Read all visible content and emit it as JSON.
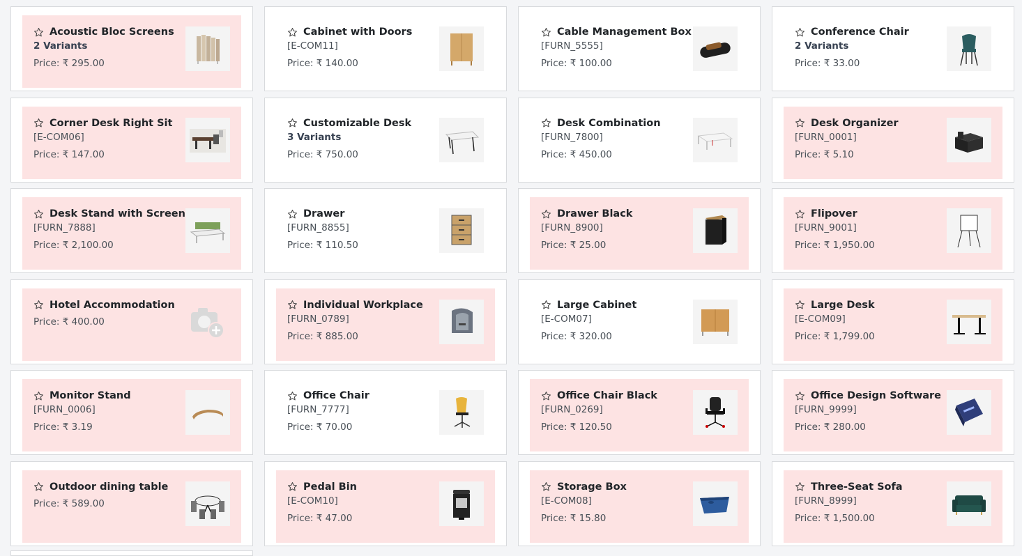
{
  "currency": "₹",
  "price_label": "Price:",
  "colors": {
    "highlight": "#fde3e3",
    "card": "#ffffff",
    "border": "#d8dadd"
  },
  "products": [
    {
      "name": "Acoustic Bloc Screens",
      "sub": "2 Variants",
      "sub_type": "variants",
      "price": "295.00",
      "highlight": true,
      "icon": "acoustic-screens"
    },
    {
      "name": "Cabinet with Doors",
      "sub": "[E-COM11]",
      "sub_type": "code",
      "price": "140.00",
      "highlight": false,
      "icon": "cabinet-doors"
    },
    {
      "name": "Cable Management Box",
      "sub": "[FURN_5555]",
      "sub_type": "code",
      "price": "100.00",
      "highlight": false,
      "icon": "cable-box"
    },
    {
      "name": "Conference Chair",
      "sub": "2 Variants",
      "sub_type": "variants",
      "price": "33.00",
      "highlight": false,
      "icon": "chair-teal"
    },
    {
      "name": "Corner Desk Right Sit",
      "sub": "[E-COM06]",
      "sub_type": "code",
      "price": "147.00",
      "highlight": true,
      "icon": "corner-desk"
    },
    {
      "name": "Customizable Desk",
      "sub": "3 Variants",
      "sub_type": "variants",
      "price": "750.00",
      "highlight": false,
      "icon": "desk-white"
    },
    {
      "name": "Desk Combination",
      "sub": "[FURN_7800]",
      "sub_type": "code",
      "price": "450.00",
      "highlight": false,
      "icon": "desk-combo"
    },
    {
      "name": "Desk Organizer",
      "sub": "[FURN_0001]",
      "sub_type": "code",
      "price": "5.10",
      "highlight": true,
      "icon": "organizer"
    },
    {
      "name": "Desk Stand with Screen",
      "sub": "[FURN_7888]",
      "sub_type": "code",
      "price": "2,100.00",
      "highlight": true,
      "icon": "desk-stand-screen"
    },
    {
      "name": "Drawer",
      "sub": "[FURN_8855]",
      "sub_type": "code",
      "price": "110.50",
      "highlight": false,
      "icon": "drawer-wood"
    },
    {
      "name": "Drawer Black",
      "sub": "[FURN_8900]",
      "sub_type": "code",
      "price": "25.00",
      "highlight": true,
      "icon": "drawer-black"
    },
    {
      "name": "Flipover",
      "sub": "[FURN_9001]",
      "sub_type": "code",
      "price": "1,950.00",
      "highlight": true,
      "icon": "flipover"
    },
    {
      "name": "Hotel Accommodation",
      "sub": "",
      "sub_type": "none",
      "price": "400.00",
      "highlight": true,
      "icon": "camera-placeholder"
    },
    {
      "name": "Individual Workplace",
      "sub": "[FURN_0789]",
      "sub_type": "code",
      "price": "885.00",
      "highlight": true,
      "icon": "workplace-pod"
    },
    {
      "name": "Large Cabinet",
      "sub": "[E-COM07]",
      "sub_type": "code",
      "price": "320.00",
      "highlight": false,
      "icon": "large-cabinet"
    },
    {
      "name": "Large Desk",
      "sub": "[E-COM09]",
      "sub_type": "code",
      "price": "1,799.00",
      "highlight": true,
      "icon": "large-desk"
    },
    {
      "name": "Monitor Stand",
      "sub": "[FURN_0006]",
      "sub_type": "code",
      "price": "3.19",
      "highlight": true,
      "icon": "monitor-stand"
    },
    {
      "name": "Office Chair",
      "sub": "[FURN_7777]",
      "sub_type": "code",
      "price": "70.00",
      "highlight": false,
      "icon": "office-chair-yellow"
    },
    {
      "name": "Office Chair Black",
      "sub": "[FURN_0269]",
      "sub_type": "code",
      "price": "120.50",
      "highlight": true,
      "icon": "office-chair-black"
    },
    {
      "name": "Office Design Software",
      "sub": "[FURN_9999]",
      "sub_type": "code",
      "price": "280.00",
      "highlight": true,
      "icon": "software-box"
    },
    {
      "name": "Outdoor dining table",
      "sub": "",
      "sub_type": "none",
      "price": "589.00",
      "highlight": true,
      "icon": "dining-table"
    },
    {
      "name": "Pedal Bin",
      "sub": "[E-COM10]",
      "sub_type": "code",
      "price": "47.00",
      "highlight": true,
      "icon": "pedal-bin"
    },
    {
      "name": "Storage Box",
      "sub": "[E-COM08]",
      "sub_type": "code",
      "price": "15.80",
      "highlight": true,
      "icon": "storage-box"
    },
    {
      "name": "Three-Seat Sofa",
      "sub": "[FURN_8999]",
      "sub_type": "code",
      "price": "1,500.00",
      "highlight": true,
      "icon": "sofa"
    }
  ]
}
